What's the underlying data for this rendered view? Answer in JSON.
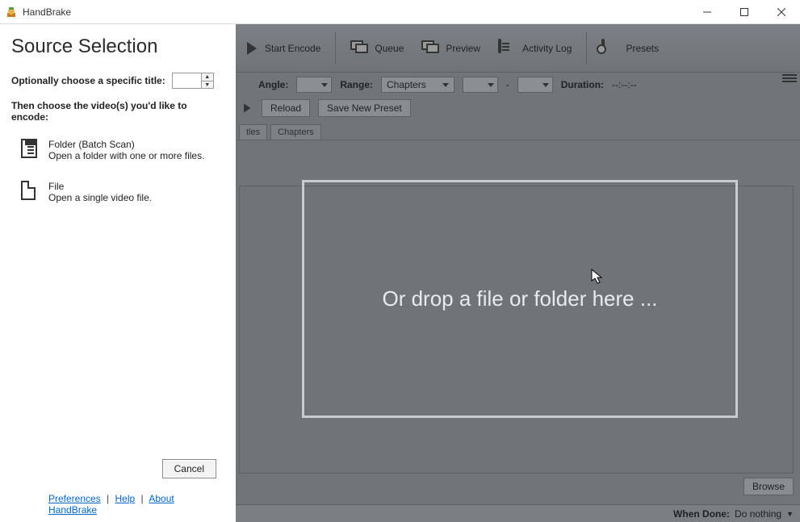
{
  "titlebar": {
    "app_name": "HandBrake"
  },
  "toolbar": {
    "start_encode": "Start Encode",
    "queue": "Queue",
    "preview": "Preview",
    "activity_log": "Activity Log",
    "presets": "Presets"
  },
  "source_row": {
    "angle_label": "Angle:",
    "range_label": "Range:",
    "range_value": "Chapters",
    "dash": "-",
    "duration_label": "Duration:",
    "duration_value": "--:--:--"
  },
  "preset_row": {
    "reload": "Reload",
    "save_new": "Save New Preset"
  },
  "tabs": {
    "titles_partial": "tles",
    "chapters": "Chapters"
  },
  "drop_zone": {
    "text": "Or drop a file or folder here ..."
  },
  "bottom": {
    "browse": "Browse",
    "when_done_label": "When Done:",
    "when_done_value": "Do nothing"
  },
  "panel": {
    "title": "Source Selection",
    "optional_title_label": "Optionally choose a specific title:",
    "title_value": "",
    "then_text": "Then choose the video(s) you'd like to encode:",
    "folder": {
      "title": "Folder (Batch Scan)",
      "desc": "Open a folder with one or more files."
    },
    "file": {
      "title": "File",
      "desc": "Open a single video file."
    },
    "cancel": "Cancel",
    "footer": {
      "prefs": "Preferences",
      "help": "Help",
      "about": "About HandBrake"
    }
  }
}
